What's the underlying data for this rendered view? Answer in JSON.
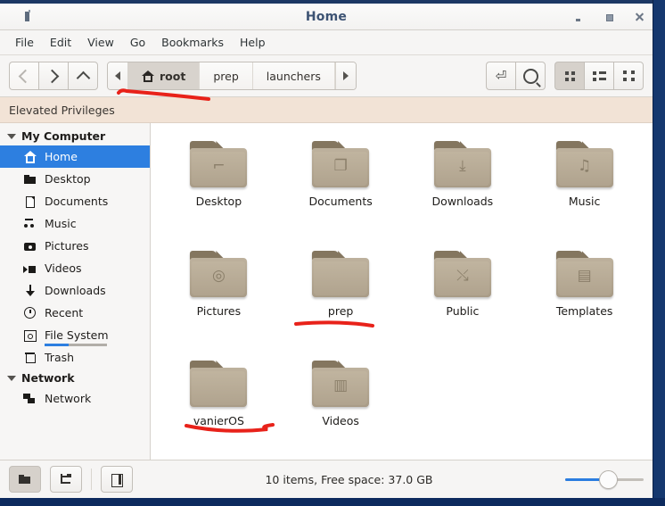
{
  "window": {
    "title": "Home",
    "app_icon": "app-icon",
    "controls": {
      "minimize": "minimize",
      "maximize": "maximize",
      "close": "close"
    }
  },
  "menubar": {
    "items": [
      {
        "label": "File"
      },
      {
        "label": "Edit"
      },
      {
        "label": "View"
      },
      {
        "label": "Go"
      },
      {
        "label": "Bookmarks"
      },
      {
        "label": "Help"
      }
    ]
  },
  "toolbar": {
    "nav": [
      {
        "name": "back-button",
        "icon": "chevron-left-icon",
        "enabled": false
      },
      {
        "name": "forward-button",
        "icon": "chevron-right-icon",
        "enabled": true
      },
      {
        "name": "up-button",
        "icon": "chevron-up-icon",
        "enabled": true
      }
    ],
    "breadcrumb": {
      "scroll_left": "triangle-left-icon",
      "scroll_right": "triangle-right-icon",
      "items": [
        {
          "label": "root",
          "icon": "home-icon",
          "current": true
        },
        {
          "label": "prep",
          "current": false
        },
        {
          "label": "launchers",
          "current": false
        }
      ]
    },
    "actions": [
      {
        "name": "toggle-path-entry-button",
        "icon": "path-entry-icon",
        "glyph": "⏎"
      },
      {
        "name": "search-button",
        "icon": "search-icon"
      }
    ],
    "view_modes": [
      {
        "name": "icon-view-button",
        "icon": "grid-view-icon",
        "active": true
      },
      {
        "name": "list-view-button",
        "icon": "list-view-icon",
        "active": false
      },
      {
        "name": "compact-view-button",
        "icon": "compact-view-icon",
        "active": false
      }
    ]
  },
  "notice": {
    "text": "Elevated Privileges"
  },
  "sidebar": {
    "groups": [
      {
        "label": "My Computer",
        "expanded": true,
        "items": [
          {
            "label": "Home",
            "icon": "home-icon",
            "selected": true
          },
          {
            "label": "Desktop",
            "icon": "folder-icon",
            "selected": false
          },
          {
            "label": "Documents",
            "icon": "document-icon",
            "selected": false
          },
          {
            "label": "Music",
            "icon": "music-icon",
            "selected": false
          },
          {
            "label": "Pictures",
            "icon": "camera-icon",
            "selected": false
          },
          {
            "label": "Videos",
            "icon": "video-icon",
            "selected": false
          },
          {
            "label": "Downloads",
            "icon": "download-arrow-icon",
            "selected": false
          },
          {
            "label": "Recent",
            "icon": "clock-icon",
            "selected": false
          },
          {
            "label": "File System",
            "icon": "disk-icon",
            "selected": false,
            "usage_percent": 38
          },
          {
            "label": "Trash",
            "icon": "trash-icon",
            "selected": false
          }
        ]
      },
      {
        "label": "Network",
        "expanded": true,
        "items": [
          {
            "label": "Network",
            "icon": "network-icon",
            "selected": false
          }
        ]
      }
    ]
  },
  "files": [
    {
      "label": "Desktop",
      "icon": "folder-desktop-icon",
      "emblem": "⌐"
    },
    {
      "label": "Documents",
      "icon": "folder-documents-icon",
      "emblem": "❐"
    },
    {
      "label": "Downloads",
      "icon": "folder-downloads-icon",
      "emblem": "⤓"
    },
    {
      "label": "Music",
      "icon": "folder-music-icon",
      "emblem": "♫"
    },
    {
      "label": "Pictures",
      "icon": "folder-pictures-icon",
      "emblem": "◎"
    },
    {
      "label": "prep",
      "icon": "folder-icon",
      "emblem": ""
    },
    {
      "label": "Public",
      "icon": "folder-public-icon",
      "emblem": "⤯"
    },
    {
      "label": "Templates",
      "icon": "folder-templates-icon",
      "emblem": "▤"
    },
    {
      "label": "vanierOS",
      "icon": "folder-icon",
      "emblem": ""
    },
    {
      "label": "Videos",
      "icon": "folder-videos-icon",
      "emblem": "▥"
    }
  ],
  "statusbar": {
    "buttons": [
      {
        "name": "places-view-button",
        "icon": "places-icon",
        "active": true
      },
      {
        "name": "tree-view-button",
        "icon": "tree-icon",
        "active": false
      },
      {
        "name": "toggle-sidebar-button",
        "icon": "sidebar-toggle-icon",
        "active": false
      }
    ],
    "status_text": "10 items, Free space: 37.0 GB",
    "zoom_slider": {
      "name": "zoom-slider",
      "value": 55
    }
  },
  "annotations": [
    {
      "name": "annotation-breadcrumb-underline",
      "color": "#e8221a"
    },
    {
      "name": "annotation-prep-underline",
      "color": "#e8221a"
    },
    {
      "name": "annotation-vanieros-underline",
      "color": "#e8221a"
    }
  ],
  "colors": {
    "accent": "#2d7fe0",
    "folder": "#b2a590",
    "notice_bg": "#f2e3d6",
    "desktop": "#0d2a5e"
  }
}
